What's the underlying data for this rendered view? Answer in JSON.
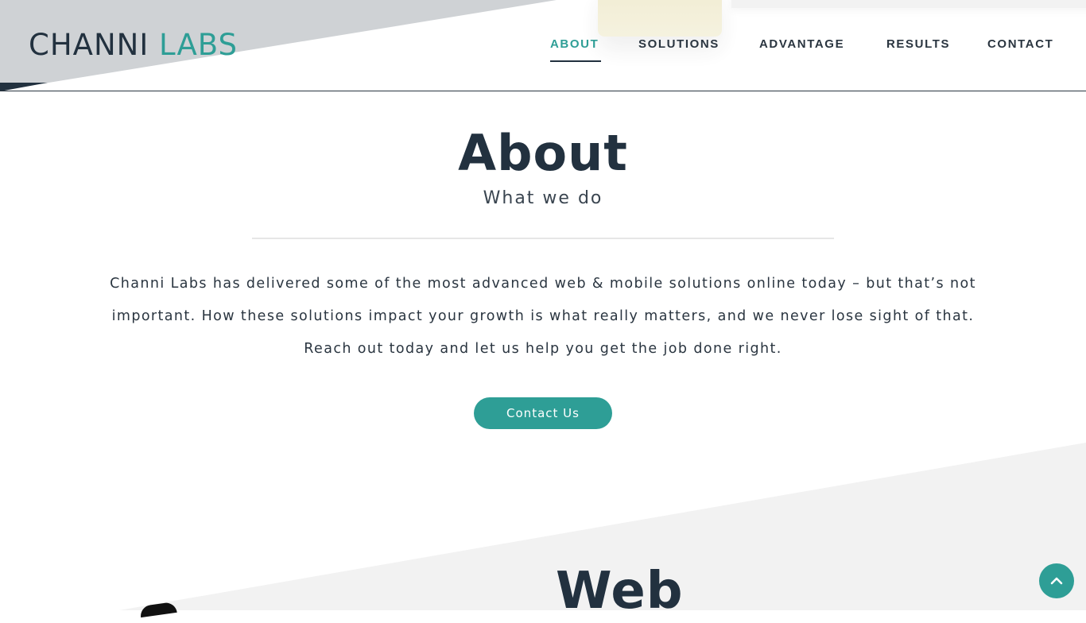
{
  "header": {
    "logo": {
      "part1": "CHANNI",
      "part2": "LABS"
    },
    "nav": [
      {
        "label": "ABOUT",
        "active": true
      },
      {
        "label": "SOLUTIONS",
        "active": false
      },
      {
        "label": "ADVANTAGE",
        "active": false
      },
      {
        "label": "RESULTS",
        "active": false
      },
      {
        "label": "CONTACT",
        "active": false
      }
    ]
  },
  "about": {
    "title": "About",
    "subtitle": "What we do",
    "body": "Channi Labs has delivered some of the most advanced web & mobile solutions online today – but that’s not important. How these solutions impact your growth is what really matters, and we never lose sight of that. Reach out today and let us help you get the job done right.",
    "cta_label": "Contact Us"
  },
  "next_section": {
    "title": "Web"
  },
  "scroll_top": {
    "icon": "chevron-up-icon"
  },
  "colors": {
    "accent": "#2e9e96",
    "dark": "#22313f",
    "header_grey": "#cfd2d5",
    "section_grey": "#f2f2f2"
  }
}
